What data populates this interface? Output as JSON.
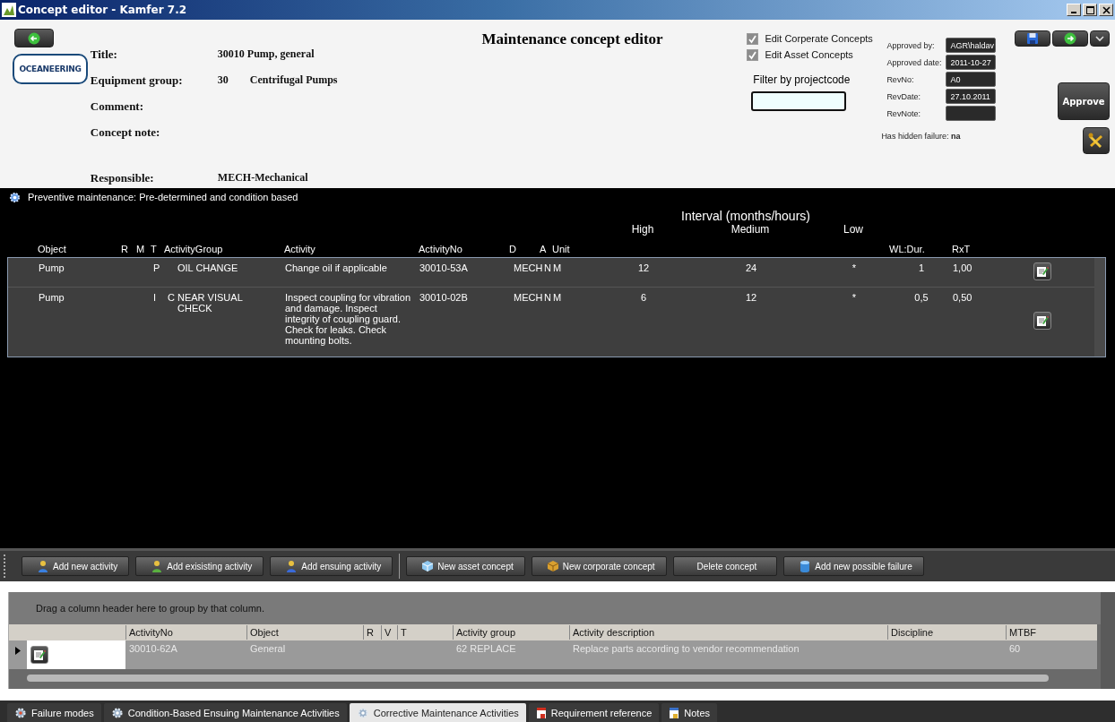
{
  "window": {
    "title": "Concept editor - Kamfer 7.2"
  },
  "header": {
    "logo_text": "OCEANEERING",
    "heading": "Maintenance concept editor",
    "fields": [
      {
        "label": "Title:",
        "values": [
          "30010 Pump, general"
        ]
      },
      {
        "label": "Equipment group:",
        "values": [
          "30",
          "Centrifugal Pumps"
        ]
      },
      {
        "label": "Comment:"
      },
      {
        "label": "Concept note:"
      },
      {
        "label": "Responsible:",
        "values": [
          "MECH-Mechanical"
        ]
      }
    ],
    "checkboxes": [
      {
        "label": "Edit Corperate Concepts",
        "checked": true
      },
      {
        "label": "Edit Asset Concepts",
        "checked": true
      }
    ],
    "filter": {
      "label": "Filter by projectcode"
    },
    "approval": [
      {
        "label": "Approved by:",
        "value": "AGR\\haldav"
      },
      {
        "label": "Approved date:",
        "value": "2011-10-27"
      },
      {
        "label": "RevNo:",
        "value": "A0"
      },
      {
        "label": "RevDate:",
        "value": "27.10.2011"
      },
      {
        "label": "RevNote:"
      }
    ],
    "approve_button": "Approve",
    "hidden_failure": {
      "label": "Has hidden failure:",
      "value": "na"
    }
  },
  "preventive": {
    "title": "Preventive maintenance: Pre-determined and condition based",
    "interval_title": "Interval (months/hours)",
    "columns": {
      "object": "Object",
      "r": "R",
      "m": "M",
      "t": "T",
      "group": "ActivityGroup",
      "activity": "Activity",
      "no": "ActivityNo",
      "d": "D",
      "a": "A",
      "unit": "Unit",
      "high": "High",
      "medium": "Medium",
      "low": "Low",
      "wl": "WL:Dur.",
      "rxt": "RxT"
    },
    "rows": [
      {
        "object": "Pump",
        "t": "P",
        "group": "OIL CHANGE",
        "activity": "Change oil if applicable",
        "no": "30010-53A",
        "d": "MECH",
        "a": "N",
        "unit": "M",
        "high": "12",
        "medium": "24",
        "low": "*",
        "wl": "1",
        "rxt": "1,00"
      },
      {
        "object": "Pump",
        "t": "I",
        "t2": "C",
        "group": "NEAR VISUAL CHECK",
        "activity": "Inspect coupling for vibration and damage. Inspect integrity of coupling guard. Check for leaks. Check mounting bolts.",
        "no": "30010-02B",
        "d": "MECH",
        "a": "N",
        "unit": "M",
        "high": "6",
        "medium": "12",
        "low": "*",
        "wl": "0,5",
        "rxt": "0,50"
      }
    ]
  },
  "toolbar": [
    {
      "label": "Add new activity",
      "kind": "person"
    },
    {
      "label": "Add exisisting activity",
      "kind": "person"
    },
    {
      "label": "Add ensuing activity",
      "kind": "person"
    },
    {
      "label": "New asset concept",
      "kind": "cube",
      "separator": true
    },
    {
      "label": "New corporate concept",
      "kind": "box"
    },
    {
      "label": "Delete concept",
      "kind": "plain"
    },
    {
      "label": "Add new possible failure",
      "kind": "cylinder"
    }
  ],
  "corrective": {
    "hint": "Drag a column header here to group by that column.",
    "columns": [
      "ActivityNo",
      "Object",
      "R",
      "V",
      "T",
      "Activity group",
      "Activity description",
      "Discipline",
      "MTBF"
    ],
    "rows": [
      {
        "cells": [
          "30010-62A",
          "General",
          null,
          null,
          null,
          "62 REPLACE",
          "Replace parts according to vendor recommendation",
          null,
          "60"
        ]
      }
    ]
  },
  "tabs": [
    {
      "label": "Failure modes",
      "selected": false
    },
    {
      "label": "Condition-Based Ensuing Maintenance Activities",
      "selected": false
    },
    {
      "label": "Corrective Maintenance Activities",
      "selected": true
    },
    {
      "label": "Requirement reference",
      "selected": false
    },
    {
      "label": "Notes",
      "selected": false
    }
  ]
}
